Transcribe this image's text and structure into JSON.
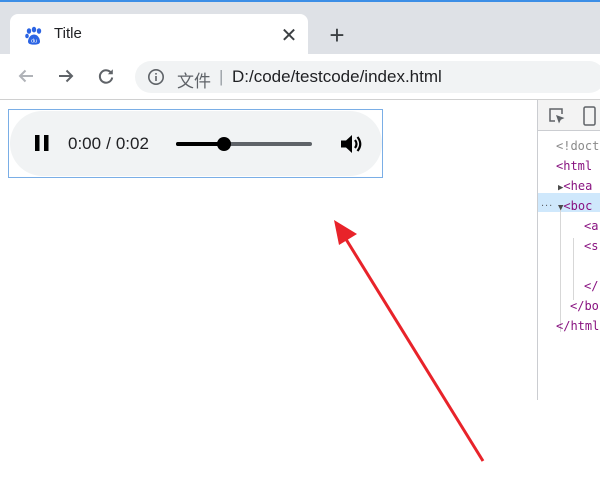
{
  "browser": {
    "tab": {
      "title": "Title",
      "close_glyph": "✕"
    },
    "new_tab_glyph": "+",
    "address_bar": {
      "file_label": "文件",
      "separator": "|",
      "url": "D:/code/testcode/index.html"
    },
    "icons": [
      "baidu-paw-favicon",
      "back-arrow-icon",
      "forward-arrow-icon",
      "reload-icon",
      "info-icon"
    ]
  },
  "audio_player": {
    "state": "playing",
    "current_time": "0:00",
    "time_separator": "/",
    "duration": "0:02",
    "progress_fraction": 0.35
  },
  "devtools": {
    "lines": [
      {
        "text": "<!doct",
        "kind": "comment"
      },
      {
        "text": "<html",
        "kind": "tag"
      },
      {
        "text": "<hea",
        "kind": "tag"
      },
      {
        "text": "<boc",
        "kind": "tag"
      },
      {
        "text": "<a",
        "kind": "tag"
      },
      {
        "text": "<s",
        "kind": "tag"
      },
      {
        "text": "</",
        "kind": "tag"
      },
      {
        "text": "</bo",
        "kind": "tag"
      },
      {
        "text": "</html",
        "kind": "tag"
      }
    ],
    "selected_marker": "..."
  },
  "colors": {
    "accent_blue": "#3c8ee6",
    "annotation_arrow": "#e8232a",
    "tag_purple": "#881280",
    "selection": "#cfe8fc"
  }
}
